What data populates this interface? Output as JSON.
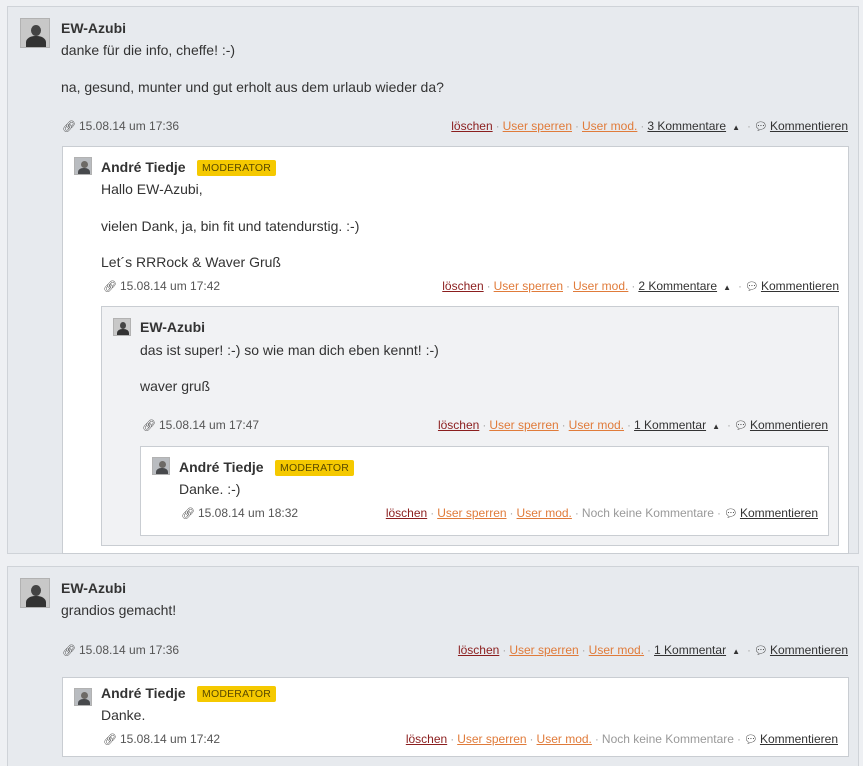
{
  "labels": {
    "delete": "löschen",
    "block_user": "User sperren",
    "user_mod": "User mod.",
    "reply": "Kommentieren",
    "no_comments": "Noch keine Kommentare",
    "moderator": "MODERATOR"
  },
  "thread1": {
    "author": "EW-Azubi",
    "lines": [
      "danke für die info, cheffe! :-)",
      "na, gesund, munter und gut erholt aus dem urlaub wieder da?"
    ],
    "time": "15.08.14 um 17:36",
    "count": "3 Kommentare",
    "reply1": {
      "author": "André Tiedje",
      "lines": [
        "Hallo EW-Azubi,",
        "vielen Dank, ja, bin fit und tatendurstig. :-)",
        "Let´s RRRock & Waver Gruß"
      ],
      "time": "15.08.14 um 17:42",
      "count": "2 Kommentare",
      "reply2": {
        "author": "EW-Azubi",
        "lines": [
          "das ist super! :-) so wie man dich eben kennt! :-)",
          "waver gruß"
        ],
        "time": "15.08.14 um 17:47",
        "count": "1 Kommentar",
        "reply3": {
          "author": "André Tiedje",
          "lines": [
            "Danke. :-)"
          ],
          "time": "15.08.14 um 18:32"
        }
      }
    }
  },
  "thread2": {
    "author": "EW-Azubi",
    "lines": [
      "grandios gemacht!"
    ],
    "time": "15.08.14 um 17:36",
    "count": "1 Kommentar",
    "reply1": {
      "author": "André Tiedje",
      "lines": [
        "Danke."
      ],
      "time": "15.08.14 um 17:42"
    }
  }
}
